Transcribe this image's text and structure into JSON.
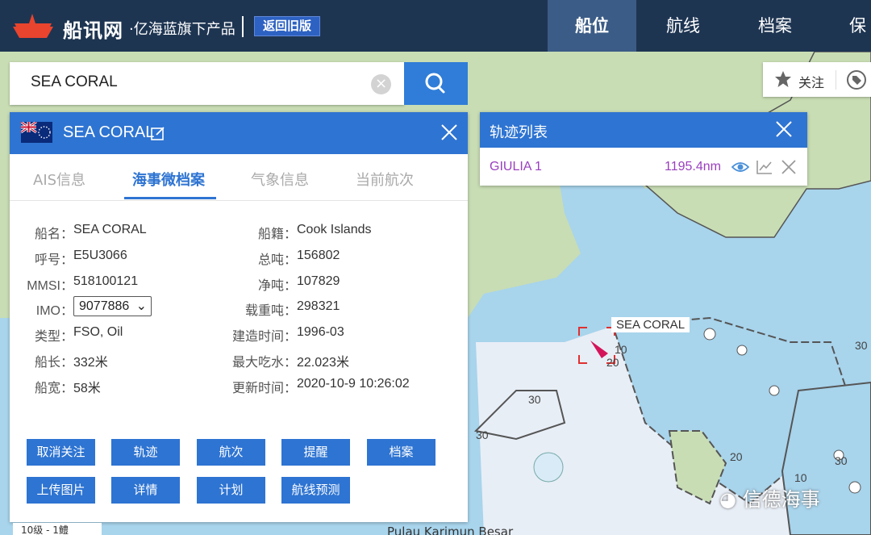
{
  "header": {
    "logo_text": "船讯网",
    "logo_sub": "·亿海蓝旗下产品",
    "old_version_label": "返回旧版",
    "nav": [
      "船位",
      "航线",
      "档案",
      "保险"
    ]
  },
  "search": {
    "value": "SEA CORAL"
  },
  "follow_label": "关注",
  "vessel_panel": {
    "title": "SEA CORAL",
    "tabs": [
      "AIS信息",
      "海事微档案",
      "气象信息",
      "当前航次"
    ],
    "left_fields": [
      {
        "label": "船名：",
        "value": "SEA CORAL"
      },
      {
        "label": "呼号：",
        "value": "E5U3066"
      },
      {
        "label": "MMSI：",
        "value": "518100121"
      },
      {
        "label": "IMO：",
        "value": "9077886"
      },
      {
        "label": "类型：",
        "value": "FSO, Oil"
      },
      {
        "label": "船长：",
        "value": "332米"
      },
      {
        "label": "船宽：",
        "value": "58米"
      }
    ],
    "right_fields": [
      {
        "label": "船籍：",
        "value": "Cook Islands"
      },
      {
        "label": "总吨：",
        "value": "156802"
      },
      {
        "label": "净吨：",
        "value": "107829"
      },
      {
        "label": "载重吨：",
        "value": "298321"
      },
      {
        "label": "建造时间：",
        "value": "1996-03"
      },
      {
        "label": "最大吃水：",
        "value": "22.023米"
      },
      {
        "label": "更新时间：",
        "value": "2020-10-9 10:26:02"
      }
    ],
    "buttons_row1": [
      "取消关注",
      "轨迹",
      "航次",
      "提醒",
      "档案"
    ],
    "buttons_row2": [
      "上传图片",
      "详情",
      "计划",
      "航线预测"
    ]
  },
  "track_panel": {
    "title": "轨迹列表",
    "entry_name": "GIULIA 1",
    "entry_distance": "1195.4nm"
  },
  "map": {
    "ship_label": "SEA CORAL",
    "depths": [
      "10",
      "20",
      "30",
      "30",
      "30",
      "20",
      "10",
      "30"
    ],
    "scale_text": "10级 - 1鳢",
    "place_text": "Pulau Karimun Besar"
  },
  "watermark": "信德海事",
  "colors": {
    "header_bg": "#1e3552",
    "accent": "#2e74d2",
    "track_text": "#9a3fbf",
    "land": "#c8ddb4",
    "water": "#a8d4ec"
  }
}
